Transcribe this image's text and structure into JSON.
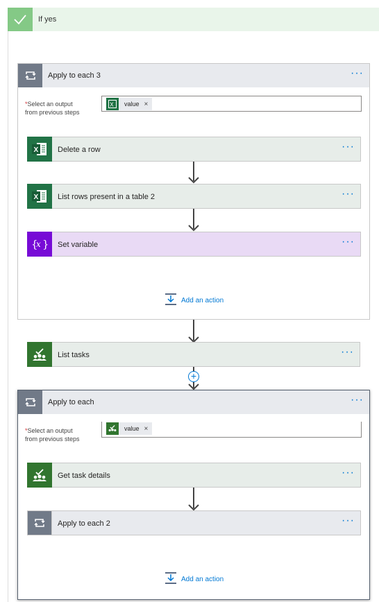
{
  "branch": {
    "title": "If yes"
  },
  "loop1": {
    "title": "Apply to each 3",
    "select_label_req": "*",
    "select_label_line1": "Select an output",
    "select_label_line2": "from previous steps",
    "token_label": "value",
    "token_remove": "×",
    "actions": [
      {
        "title": "Delete a row",
        "icon": "excel-icon"
      },
      {
        "title": "List rows present in a table 2",
        "icon": "excel-icon"
      },
      {
        "title": "Set variable",
        "icon": "variable-icon"
      }
    ],
    "add_action": "Add an action"
  },
  "list_tasks": {
    "title": "List tasks",
    "icon": "planner-icon"
  },
  "loop2": {
    "title": "Apply to each",
    "select_label_req": "*",
    "select_label_line1": "Select an output",
    "select_label_line2": "from previous steps",
    "token_label": "value",
    "token_remove": "×",
    "actions": [
      {
        "title": "Get task details",
        "icon": "planner-icon"
      },
      {
        "title": "Apply to each 2",
        "icon": "loop-icon"
      }
    ],
    "add_action": "Add an action"
  },
  "more_glyph": "···",
  "insert_glyph": "+",
  "colors": {
    "excel": "#217346",
    "planner": "#31752f",
    "variable": "#770bd6",
    "loop": "#717a88",
    "condition_yes": "#84c986",
    "accent": "#0078d4"
  }
}
